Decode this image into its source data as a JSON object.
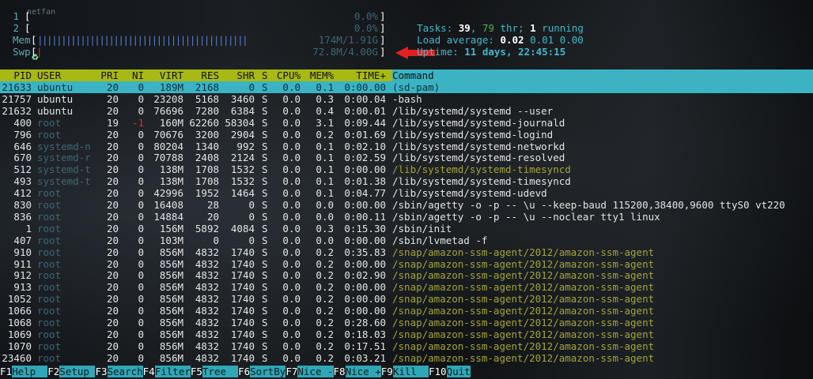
{
  "desktop": {
    "watermark": "netfan",
    "recycle_icon": "recycle-bin-icon"
  },
  "meters": {
    "cpu1": {
      "label": "1",
      "open": "[",
      "value": "0.0%",
      "close": "]",
      "fraction": 0.0
    },
    "cpu2": {
      "label": "2",
      "open": "[",
      "value": "0.0%",
      "close": "]",
      "fraction": 0.0
    },
    "mem": {
      "label": "Mem",
      "open": "[",
      "bars": "||||||||||||||||||||||||||||||||||||||||||||",
      "value": "174M/1.91G",
      "close": "]",
      "fraction": 0.09
    },
    "swp": {
      "label": "Swp",
      "open": "[",
      "value": "72.8M/4.00G",
      "close": "]",
      "fraction": 0.02
    }
  },
  "stats": {
    "tasks_label": "Tasks:",
    "tasks": "39",
    "sep1": ",",
    "threads": "79",
    "thr_label": " thr;",
    "running": "1",
    "running_label": " running",
    "load_label": "Load average:",
    "load1": "0.02",
    "load5": "0.01",
    "load15": "0.00",
    "uptime_label": "Uptime:",
    "uptime": "11 days, 22:45:15"
  },
  "columns": [
    "PID",
    "USER",
    "PRI",
    "NI",
    "VIRT",
    "RES",
    "SHR",
    "S",
    "CPU%",
    "MEM%",
    "TIME+",
    "Command"
  ],
  "processes": [
    {
      "pid": "21633",
      "user": "ubuntu",
      "pri": "20",
      "ni": "0",
      "virt": "189M",
      "res": "2168",
      "shr": "0",
      "s": "S",
      "cpu": "0.0",
      "mem": "0.1",
      "time": "0:00.00",
      "cmd": "(sd-pam)",
      "selected": true
    },
    {
      "pid": "21757",
      "user": "ubuntu",
      "pri": "20",
      "ni": "0",
      "virt": "23208",
      "res": "5168",
      "shr": "3460",
      "s": "S",
      "cpu": "0.0",
      "mem": "0.3",
      "time": "0:00.04",
      "cmd": "-bash"
    },
    {
      "pid": "21632",
      "user": "ubuntu",
      "pri": "20",
      "ni": "0",
      "virt": "76696",
      "res": "7280",
      "shr": "6384",
      "s": "S",
      "cpu": "0.0",
      "mem": "0.4",
      "time": "0:00.01",
      "cmd": "/lib/systemd/systemd --user"
    },
    {
      "pid": "400",
      "user": "root",
      "pri": "19",
      "ni": "-1",
      "virt": "160M",
      "res": "62260",
      "shr": "58304",
      "s": "S",
      "cpu": "0.0",
      "mem": "3.1",
      "time": "0:09.44",
      "cmd": "/lib/systemd/systemd-journald"
    },
    {
      "pid": "796",
      "user": "root",
      "pri": "20",
      "ni": "0",
      "virt": "70676",
      "res": "3200",
      "shr": "2904",
      "s": "S",
      "cpu": "0.0",
      "mem": "0.2",
      "time": "0:01.69",
      "cmd": "/lib/systemd/systemd-logind"
    },
    {
      "pid": "646",
      "user": "systemd-n",
      "pri": "20",
      "ni": "0",
      "virt": "80204",
      "res": "1340",
      "shr": "992",
      "s": "S",
      "cpu": "0.0",
      "mem": "0.1",
      "time": "0:02.10",
      "cmd": "/lib/systemd/systemd-networkd"
    },
    {
      "pid": "670",
      "user": "systemd-r",
      "pri": "20",
      "ni": "0",
      "virt": "70788",
      "res": "2408",
      "shr": "2124",
      "s": "S",
      "cpu": "0.0",
      "mem": "0.1",
      "time": "0:02.59",
      "cmd": "/lib/systemd/systemd-resolved"
    },
    {
      "pid": "512",
      "user": "systemd-t",
      "pri": "20",
      "ni": "0",
      "virt": "138M",
      "res": "1708",
      "shr": "1532",
      "s": "S",
      "cpu": "0.0",
      "mem": "0.1",
      "time": "0:00.00",
      "cmd": "/lib/systemd/systemd-timesyncd",
      "thread": true
    },
    {
      "pid": "493",
      "user": "systemd-t",
      "pri": "20",
      "ni": "0",
      "virt": "138M",
      "res": "1708",
      "shr": "1532",
      "s": "S",
      "cpu": "0.0",
      "mem": "0.1",
      "time": "0:01.38",
      "cmd": "/lib/systemd/systemd-timesyncd"
    },
    {
      "pid": "412",
      "user": "root",
      "pri": "20",
      "ni": "0",
      "virt": "42996",
      "res": "1952",
      "shr": "1464",
      "s": "S",
      "cpu": "0.0",
      "mem": "0.1",
      "time": "0:04.77",
      "cmd": "/lib/systemd/systemd-udevd"
    },
    {
      "pid": "830",
      "user": "root",
      "pri": "20",
      "ni": "0",
      "virt": "16408",
      "res": "28",
      "shr": "0",
      "s": "S",
      "cpu": "0.0",
      "mem": "0.0",
      "time": "0:00.00",
      "cmd": "/sbin/agetty -o -p -- \\u --keep-baud 115200,38400,9600 ttyS0 vt220"
    },
    {
      "pid": "836",
      "user": "root",
      "pri": "20",
      "ni": "0",
      "virt": "14884",
      "res": "20",
      "shr": "0",
      "s": "S",
      "cpu": "0.0",
      "mem": "0.0",
      "time": "0:00.11",
      "cmd": "/sbin/agetty -o -p -- \\u --noclear tty1 linux"
    },
    {
      "pid": "1",
      "user": "root",
      "pri": "20",
      "ni": "0",
      "virt": "156M",
      "res": "5892",
      "shr": "4084",
      "s": "S",
      "cpu": "0.0",
      "mem": "0.3",
      "time": "0:15.30",
      "cmd": "/sbin/init"
    },
    {
      "pid": "407",
      "user": "root",
      "pri": "20",
      "ni": "0",
      "virt": "103M",
      "res": "0",
      "shr": "0",
      "s": "S",
      "cpu": "0.0",
      "mem": "0.0",
      "time": "0:00.00",
      "cmd": "/sbin/lvmetad -f"
    },
    {
      "pid": "910",
      "user": "root",
      "pri": "20",
      "ni": "0",
      "virt": "856M",
      "res": "4832",
      "shr": "1740",
      "s": "S",
      "cpu": "0.0",
      "mem": "0.2",
      "time": "0:35.83",
      "cmd": "/snap/amazon-ssm-agent/2012/amazon-ssm-agent",
      "thread": true
    },
    {
      "pid": "911",
      "user": "root",
      "pri": "20",
      "ni": "0",
      "virt": "856M",
      "res": "4832",
      "shr": "1740",
      "s": "S",
      "cpu": "0.0",
      "mem": "0.2",
      "time": "0:00.00",
      "cmd": "/snap/amazon-ssm-agent/2012/amazon-ssm-agent",
      "thread": true
    },
    {
      "pid": "912",
      "user": "root",
      "pri": "20",
      "ni": "0",
      "virt": "856M",
      "res": "4832",
      "shr": "1740",
      "s": "S",
      "cpu": "0.0",
      "mem": "0.2",
      "time": "0:02.90",
      "cmd": "/snap/amazon-ssm-agent/2012/amazon-ssm-agent",
      "thread": true
    },
    {
      "pid": "913",
      "user": "root",
      "pri": "20",
      "ni": "0",
      "virt": "856M",
      "res": "4832",
      "shr": "1740",
      "s": "S",
      "cpu": "0.0",
      "mem": "0.2",
      "time": "0:00.00",
      "cmd": "/snap/amazon-ssm-agent/2012/amazon-ssm-agent",
      "thread": true
    },
    {
      "pid": "1052",
      "user": "root",
      "pri": "20",
      "ni": "0",
      "virt": "856M",
      "res": "4832",
      "shr": "1740",
      "s": "S",
      "cpu": "0.0",
      "mem": "0.2",
      "time": "0:00.00",
      "cmd": "/snap/amazon-ssm-agent/2012/amazon-ssm-agent",
      "thread": true
    },
    {
      "pid": "1066",
      "user": "root",
      "pri": "20",
      "ni": "0",
      "virt": "856M",
      "res": "4832",
      "shr": "1740",
      "s": "S",
      "cpu": "0.0",
      "mem": "0.2",
      "time": "0:00.00",
      "cmd": "/snap/amazon-ssm-agent/2012/amazon-ssm-agent",
      "thread": true
    },
    {
      "pid": "1068",
      "user": "root",
      "pri": "20",
      "ni": "0",
      "virt": "856M",
      "res": "4832",
      "shr": "1740",
      "s": "S",
      "cpu": "0.0",
      "mem": "0.2",
      "time": "0:28.60",
      "cmd": "/snap/amazon-ssm-agent/2012/amazon-ssm-agent",
      "thread": true
    },
    {
      "pid": "1069",
      "user": "root",
      "pri": "20",
      "ni": "0",
      "virt": "856M",
      "res": "4832",
      "shr": "1740",
      "s": "S",
      "cpu": "0.0",
      "mem": "0.2",
      "time": "0:18.03",
      "cmd": "/snap/amazon-ssm-agent/2012/amazon-ssm-agent",
      "thread": true
    },
    {
      "pid": "1070",
      "user": "root",
      "pri": "20",
      "ni": "0",
      "virt": "856M",
      "res": "4832",
      "shr": "1740",
      "s": "S",
      "cpu": "0.0",
      "mem": "0.2",
      "time": "0:17.51",
      "cmd": "/snap/amazon-ssm-agent/2012/amazon-ssm-agent",
      "thread": true
    },
    {
      "pid": "23460",
      "user": "root",
      "pri": "20",
      "ni": "0",
      "virt": "856M",
      "res": "4832",
      "shr": "1740",
      "s": "S",
      "cpu": "0.0",
      "mem": "0.2",
      "time": "0:03.21",
      "cmd": "/snap/amazon-ssm-agent/2012/amazon-ssm-agent",
      "thread": true
    }
  ],
  "footer": [
    {
      "key": "F1",
      "label": "Help  "
    },
    {
      "key": "F2",
      "label": "Setup "
    },
    {
      "key": "F3",
      "label": "Search"
    },
    {
      "key": "F4",
      "label": "Filter"
    },
    {
      "key": "F5",
      "label": "Tree  "
    },
    {
      "key": "F6",
      "label": "SortBy"
    },
    {
      "key": "F7",
      "label": "Nice -"
    },
    {
      "key": "F8",
      "label": "Nice +"
    },
    {
      "key": "F9",
      "label": "Kill  "
    },
    {
      "key": "F10",
      "label": "Quit"
    }
  ],
  "colors": {
    "header_bar": "#a8b814",
    "selected_row": "#3bb3c3",
    "thread_cmd": "#a4a43a",
    "dim_user": "#3e6672",
    "arrow": "#e02020"
  }
}
